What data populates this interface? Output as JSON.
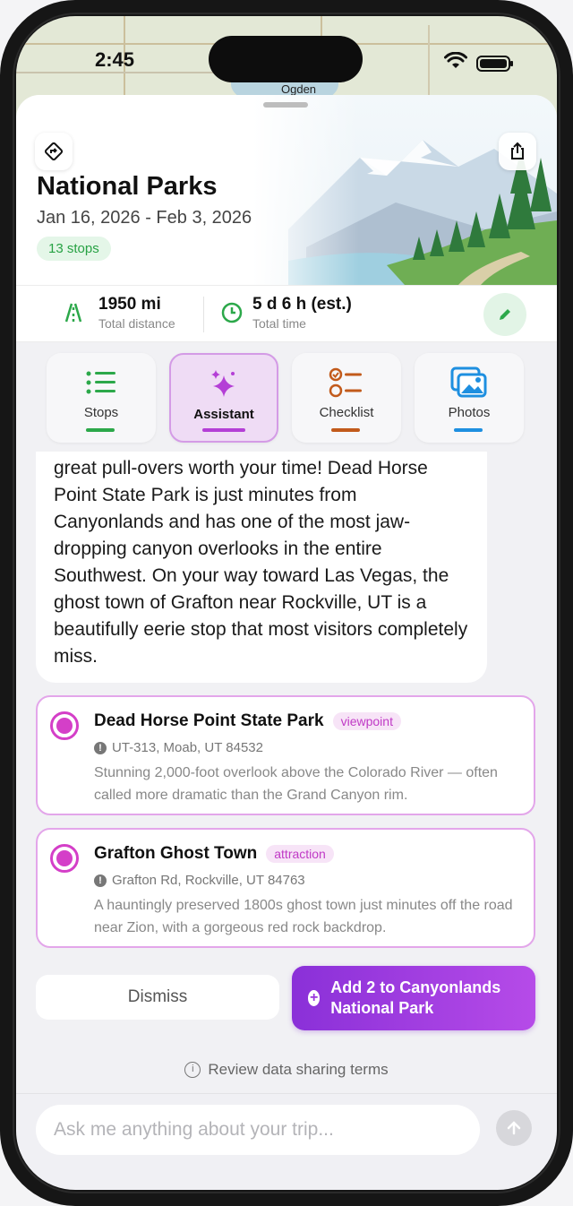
{
  "status_bar": {
    "time": "2:45",
    "wifi_icon": "wifi-icon",
    "battery_icon": "battery-icon"
  },
  "map": {
    "place_label": "Ogden"
  },
  "trip": {
    "title": "National Parks",
    "dates": "Jan 16, 2026 - Feb 3, 2026",
    "stops_badge": "13 stops",
    "route_icon": "directions-icon",
    "share_icon": "share-icon"
  },
  "stats": {
    "distance_value": "1950 mi",
    "distance_label": "Total distance",
    "time_value": "5 d 6 h (est.)",
    "time_label": "Total time",
    "edit_icon": "pencil-icon"
  },
  "tabs": [
    {
      "label": "Stops",
      "icon": "list-icon",
      "color": "#2ca84a"
    },
    {
      "label": "Assistant",
      "icon": "sparkles-icon",
      "color": "#b43fd6",
      "active": true
    },
    {
      "label": "Checklist",
      "icon": "checklist-icon",
      "color": "#c25a1b"
    },
    {
      "label": "Photos",
      "icon": "photos-icon",
      "color": "#1e8fe0"
    }
  ],
  "assistant_message": "great pull-overs worth your time! Dead Horse Point State Park is just minutes from Canyonlands and has one of the most jaw-dropping canyon overlooks in the entire Southwest. On your way toward Las Vegas, the ghost town of Grafton near Rockville, UT is a beautifully eerie stop that most visitors completely miss.",
  "suggestions": [
    {
      "name": "Dead Horse Point State Park",
      "tag": "viewpoint",
      "address": "UT-313, Moab, UT 84532",
      "description": "Stunning 2,000-foot overlook above the Colorado River — often called more dramatic than the Grand Canyon rim."
    },
    {
      "name": "Grafton Ghost Town",
      "tag": "attraction",
      "address": "Grafton Rd, Rockville, UT 84763",
      "description": "A hauntingly preserved 1800s ghost town just minutes off the road near Zion, with a gorgeous red rock backdrop."
    }
  ],
  "actions": {
    "dismiss_label": "Dismiss",
    "add_label": "Add 2 to Canyonlands National Park"
  },
  "review_link": "Review data sharing terms",
  "chat": {
    "placeholder": "Ask me anything about your trip...",
    "send_icon": "arrow-up-icon"
  },
  "colors": {
    "accent_purple": "#9a36dc",
    "selected_magenta": "#d43fc8",
    "green": "#2ca84a"
  }
}
